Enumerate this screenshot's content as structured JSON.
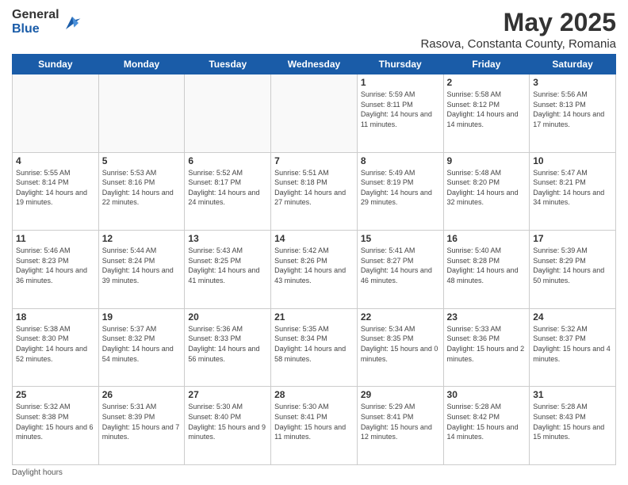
{
  "logo": {
    "general": "General",
    "blue": "Blue"
  },
  "title": "May 2025",
  "location": "Rasova, Constanta County, Romania",
  "weekdays": [
    "Sunday",
    "Monday",
    "Tuesday",
    "Wednesday",
    "Thursday",
    "Friday",
    "Saturday"
  ],
  "footer": "Daylight hours",
  "weeks": [
    [
      {
        "day": "",
        "sunrise": "",
        "sunset": "",
        "daylight": ""
      },
      {
        "day": "",
        "sunrise": "",
        "sunset": "",
        "daylight": ""
      },
      {
        "day": "",
        "sunrise": "",
        "sunset": "",
        "daylight": ""
      },
      {
        "day": "",
        "sunrise": "",
        "sunset": "",
        "daylight": ""
      },
      {
        "day": "1",
        "sunrise": "Sunrise: 5:59 AM",
        "sunset": "Sunset: 8:11 PM",
        "daylight": "Daylight: 14 hours and 11 minutes."
      },
      {
        "day": "2",
        "sunrise": "Sunrise: 5:58 AM",
        "sunset": "Sunset: 8:12 PM",
        "daylight": "Daylight: 14 hours and 14 minutes."
      },
      {
        "day": "3",
        "sunrise": "Sunrise: 5:56 AM",
        "sunset": "Sunset: 8:13 PM",
        "daylight": "Daylight: 14 hours and 17 minutes."
      }
    ],
    [
      {
        "day": "4",
        "sunrise": "Sunrise: 5:55 AM",
        "sunset": "Sunset: 8:14 PM",
        "daylight": "Daylight: 14 hours and 19 minutes."
      },
      {
        "day": "5",
        "sunrise": "Sunrise: 5:53 AM",
        "sunset": "Sunset: 8:16 PM",
        "daylight": "Daylight: 14 hours and 22 minutes."
      },
      {
        "day": "6",
        "sunrise": "Sunrise: 5:52 AM",
        "sunset": "Sunset: 8:17 PM",
        "daylight": "Daylight: 14 hours and 24 minutes."
      },
      {
        "day": "7",
        "sunrise": "Sunrise: 5:51 AM",
        "sunset": "Sunset: 8:18 PM",
        "daylight": "Daylight: 14 hours and 27 minutes."
      },
      {
        "day": "8",
        "sunrise": "Sunrise: 5:49 AM",
        "sunset": "Sunset: 8:19 PM",
        "daylight": "Daylight: 14 hours and 29 minutes."
      },
      {
        "day": "9",
        "sunrise": "Sunrise: 5:48 AM",
        "sunset": "Sunset: 8:20 PM",
        "daylight": "Daylight: 14 hours and 32 minutes."
      },
      {
        "day": "10",
        "sunrise": "Sunrise: 5:47 AM",
        "sunset": "Sunset: 8:21 PM",
        "daylight": "Daylight: 14 hours and 34 minutes."
      }
    ],
    [
      {
        "day": "11",
        "sunrise": "Sunrise: 5:46 AM",
        "sunset": "Sunset: 8:23 PM",
        "daylight": "Daylight: 14 hours and 36 minutes."
      },
      {
        "day": "12",
        "sunrise": "Sunrise: 5:44 AM",
        "sunset": "Sunset: 8:24 PM",
        "daylight": "Daylight: 14 hours and 39 minutes."
      },
      {
        "day": "13",
        "sunrise": "Sunrise: 5:43 AM",
        "sunset": "Sunset: 8:25 PM",
        "daylight": "Daylight: 14 hours and 41 minutes."
      },
      {
        "day": "14",
        "sunrise": "Sunrise: 5:42 AM",
        "sunset": "Sunset: 8:26 PM",
        "daylight": "Daylight: 14 hours and 43 minutes."
      },
      {
        "day": "15",
        "sunrise": "Sunrise: 5:41 AM",
        "sunset": "Sunset: 8:27 PM",
        "daylight": "Daylight: 14 hours and 46 minutes."
      },
      {
        "day": "16",
        "sunrise": "Sunrise: 5:40 AM",
        "sunset": "Sunset: 8:28 PM",
        "daylight": "Daylight: 14 hours and 48 minutes."
      },
      {
        "day": "17",
        "sunrise": "Sunrise: 5:39 AM",
        "sunset": "Sunset: 8:29 PM",
        "daylight": "Daylight: 14 hours and 50 minutes."
      }
    ],
    [
      {
        "day": "18",
        "sunrise": "Sunrise: 5:38 AM",
        "sunset": "Sunset: 8:30 PM",
        "daylight": "Daylight: 14 hours and 52 minutes."
      },
      {
        "day": "19",
        "sunrise": "Sunrise: 5:37 AM",
        "sunset": "Sunset: 8:32 PM",
        "daylight": "Daylight: 14 hours and 54 minutes."
      },
      {
        "day": "20",
        "sunrise": "Sunrise: 5:36 AM",
        "sunset": "Sunset: 8:33 PM",
        "daylight": "Daylight: 14 hours and 56 minutes."
      },
      {
        "day": "21",
        "sunrise": "Sunrise: 5:35 AM",
        "sunset": "Sunset: 8:34 PM",
        "daylight": "Daylight: 14 hours and 58 minutes."
      },
      {
        "day": "22",
        "sunrise": "Sunrise: 5:34 AM",
        "sunset": "Sunset: 8:35 PM",
        "daylight": "Daylight: 15 hours and 0 minutes."
      },
      {
        "day": "23",
        "sunrise": "Sunrise: 5:33 AM",
        "sunset": "Sunset: 8:36 PM",
        "daylight": "Daylight: 15 hours and 2 minutes."
      },
      {
        "day": "24",
        "sunrise": "Sunrise: 5:32 AM",
        "sunset": "Sunset: 8:37 PM",
        "daylight": "Daylight: 15 hours and 4 minutes."
      }
    ],
    [
      {
        "day": "25",
        "sunrise": "Sunrise: 5:32 AM",
        "sunset": "Sunset: 8:38 PM",
        "daylight": "Daylight: 15 hours and 6 minutes."
      },
      {
        "day": "26",
        "sunrise": "Sunrise: 5:31 AM",
        "sunset": "Sunset: 8:39 PM",
        "daylight": "Daylight: 15 hours and 7 minutes."
      },
      {
        "day": "27",
        "sunrise": "Sunrise: 5:30 AM",
        "sunset": "Sunset: 8:40 PM",
        "daylight": "Daylight: 15 hours and 9 minutes."
      },
      {
        "day": "28",
        "sunrise": "Sunrise: 5:30 AM",
        "sunset": "Sunset: 8:41 PM",
        "daylight": "Daylight: 15 hours and 11 minutes."
      },
      {
        "day": "29",
        "sunrise": "Sunrise: 5:29 AM",
        "sunset": "Sunset: 8:41 PM",
        "daylight": "Daylight: 15 hours and 12 minutes."
      },
      {
        "day": "30",
        "sunrise": "Sunrise: 5:28 AM",
        "sunset": "Sunset: 8:42 PM",
        "daylight": "Daylight: 15 hours and 14 minutes."
      },
      {
        "day": "31",
        "sunrise": "Sunrise: 5:28 AM",
        "sunset": "Sunset: 8:43 PM",
        "daylight": "Daylight: 15 hours and 15 minutes."
      }
    ]
  ]
}
